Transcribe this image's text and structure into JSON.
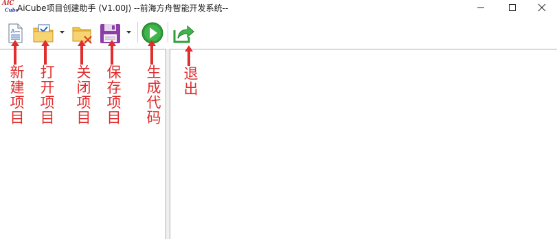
{
  "window": {
    "title": "AiCube项目创建助手 (V1.00J) --前海方舟智能开发系统--",
    "logo_line1": "AiC",
    "logo_line2": "Cube"
  },
  "toolbar": {
    "buttons": [
      {
        "id": "new",
        "icon": "new-document-icon"
      },
      {
        "id": "open",
        "icon": "open-folder-icon"
      },
      {
        "id": "close",
        "icon": "close-folder-icon"
      },
      {
        "id": "save",
        "icon": "floppy-disk-icon"
      },
      {
        "id": "generate",
        "icon": "play-icon"
      },
      {
        "id": "exit",
        "icon": "exit-arrow-icon"
      }
    ]
  },
  "annotations": {
    "new": "新建项目",
    "open": "打开项目",
    "close": "关闭项目",
    "save": "保存项目",
    "generate": "生成代码",
    "exit": "退出"
  },
  "colors": {
    "annotation_red": "#e02d2d",
    "play_green": "#2e9e3a",
    "floppy_purple": "#8b3fa6",
    "folder_yellow": "#f5c64a"
  }
}
